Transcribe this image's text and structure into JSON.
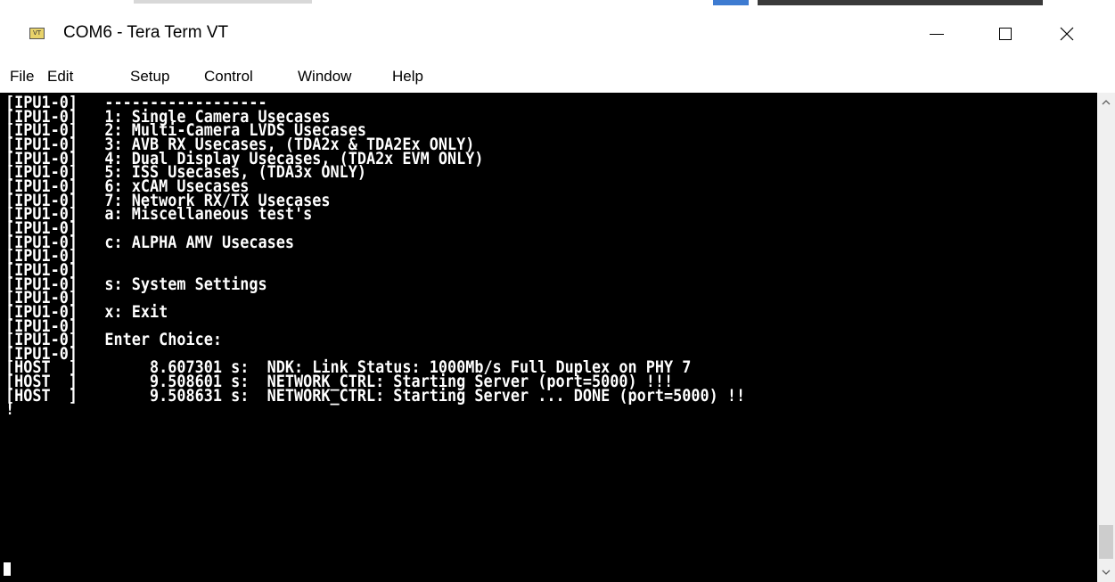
{
  "window": {
    "title": "COM6 - Tera Term VT",
    "icon_label": "VT",
    "controls": {
      "close_glyph": "✕"
    }
  },
  "menu": {
    "items": [
      {
        "label": "File"
      },
      {
        "label": "Edit"
      },
      {
        "label": "Setup"
      },
      {
        "label": "Control"
      },
      {
        "label": "Window"
      },
      {
        "label": "Help"
      }
    ]
  },
  "terminal": {
    "lines": [
      "[IPU1-0]   ------------------",
      "[IPU1-0]   1: Single Camera Usecases",
      "[IPU1-0]   2: Multi-Camera LVDS Usecases",
      "[IPU1-0]   3: AVB RX Usecases, (TDA2x & TDA2Ex ONLY)",
      "[IPU1-0]   4: Dual Display Usecases, (TDA2x EVM ONLY)",
      "[IPU1-0]   5: ISS Usecases, (TDA3x ONLY)",
      "[IPU1-0]   6: xCAM Usecases",
      "[IPU1-0]   7: Network RX/TX Usecases",
      "[IPU1-0]   a: Miscellaneous test's",
      "[IPU1-0]",
      "[IPU1-0]   c: ALPHA AMV Usecases",
      "[IPU1-0]",
      "[IPU1-0]",
      "[IPU1-0]   s: System Settings",
      "[IPU1-0]",
      "[IPU1-0]   x: Exit",
      "[IPU1-0]",
      "[IPU1-0]   Enter Choice:",
      "[IPU1-0]",
      "[HOST  ]        8.607301 s:  NDK: Link Status: 1000Mb/s Full Duplex on PHY 7",
      "[HOST  ]        9.508601 s:  NETWORK_CTRL: Starting Server (port=5000) !!!",
      "[HOST  ]        9.508631 s:  NETWORK_CTRL: Starting Server ... DONE (port=5000) !!",
      "!"
    ]
  },
  "scrollbar": {
    "up_glyph": "▲",
    "down_glyph": "▼"
  },
  "colors": {
    "terminal_bg": "#000000",
    "terminal_fg": "#ffffff"
  }
}
